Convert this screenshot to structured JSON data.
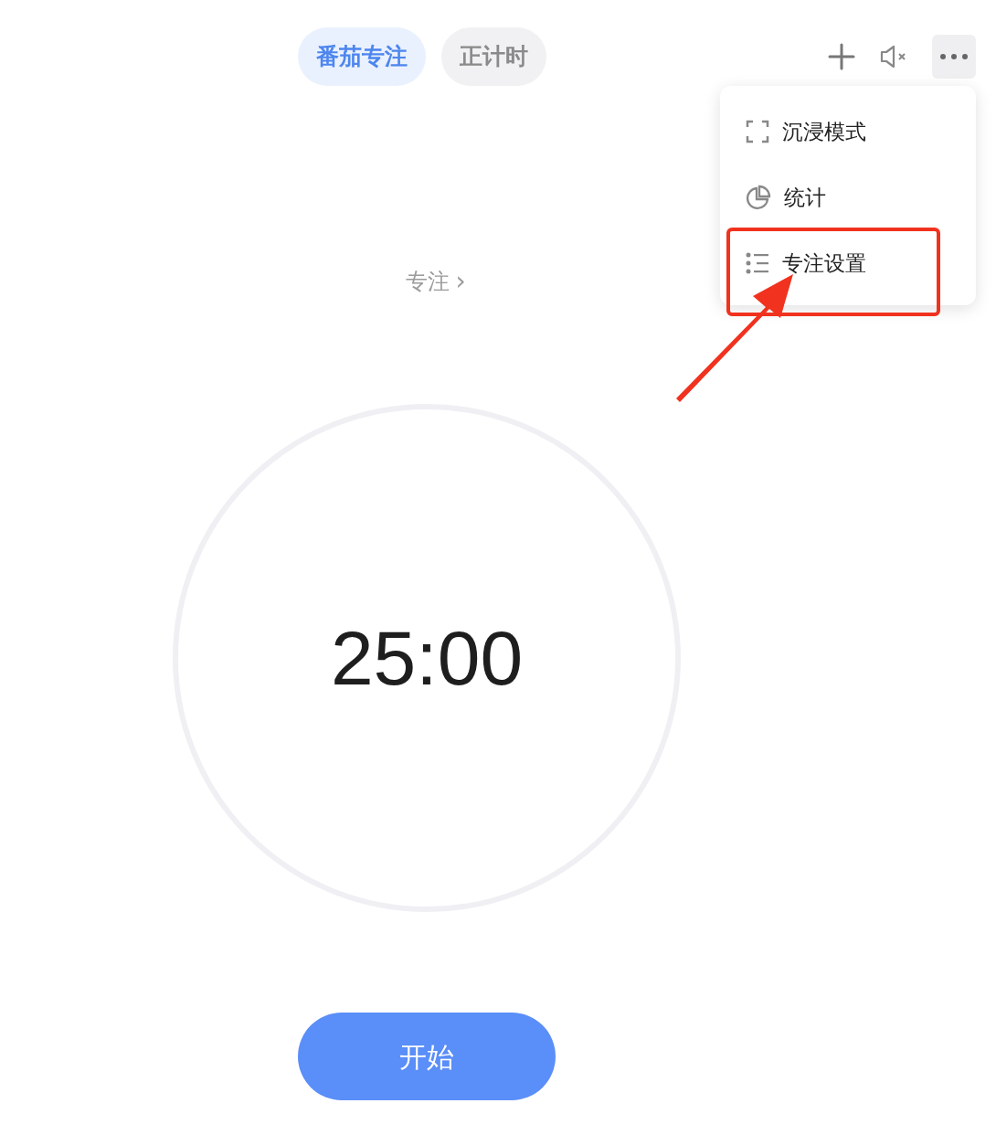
{
  "tabs": [
    {
      "label": "番茄专注",
      "selected": true
    },
    {
      "label": "正计时",
      "selected": false
    }
  ],
  "toolbar": [
    {
      "kind": "add"
    },
    {
      "kind": "mute"
    },
    {
      "kind": "more",
      "pressed": true
    }
  ],
  "menu": {
    "items": [
      {
        "kind": "fullscreen",
        "label": "沉浸模式",
        "annotated": false
      },
      {
        "kind": "stats",
        "label": "统计",
        "annotated": false
      },
      {
        "kind": "settings",
        "label": "专注设置",
        "annotated": true
      }
    ]
  },
  "focus_label": "专注",
  "focus_chevron": "›",
  "timer": "25:00",
  "start_button": "开始"
}
